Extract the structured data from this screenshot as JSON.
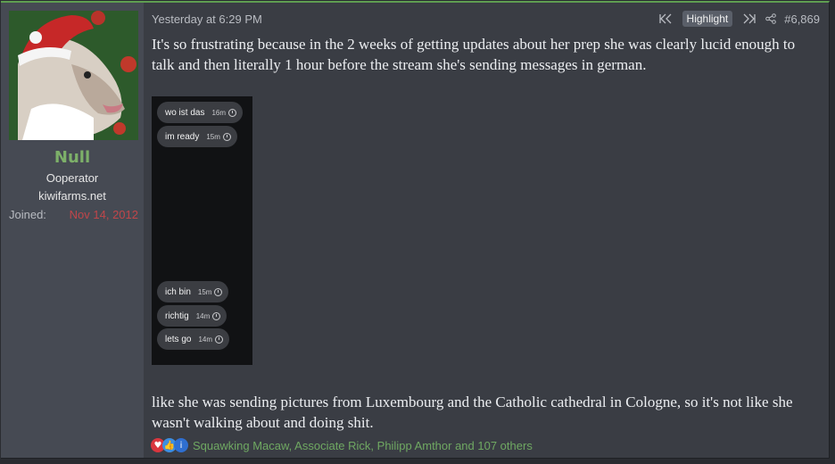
{
  "user": {
    "name": "Null",
    "title": "Ooperator",
    "banner": "kiwifarms.net",
    "joined_label": "Joined:",
    "joined_date": "Nov 14, 2012"
  },
  "post": {
    "date": "Yesterday at 6:29 PM",
    "highlight_label": "Highlight",
    "number": "#6,869",
    "paragraph1": "It's so frustrating because in the 2 weeks of getting updates about her prep she was clearly lucid enough to talk and then literally 1 hour before the stream she's sending messages in german.",
    "paragraph2": "like she was sending pictures from Luxembourg and the Catholic cathedral in Cologne, so it's not like she wasn't walking about and doing shit."
  },
  "attachment": {
    "messages": [
      {
        "text": "wo ist das",
        "time": "16m"
      },
      {
        "text": "im ready",
        "time": "15m"
      },
      {
        "text": "ich bin",
        "time": "15m"
      },
      {
        "text": "richtig",
        "time": "14m"
      },
      {
        "text": "lets go",
        "time": "14m"
      }
    ]
  },
  "reactions": {
    "icons": [
      "heart-icon",
      "thumbs-up-icon",
      "info-icon"
    ],
    "colors": {
      "heart": "#d9363e",
      "like": "#3d8ee0",
      "info": "#2f6fd1"
    },
    "users_text": "Squawking Macaw, Associate Rick, Philipp Amthor and 107 others"
  },
  "colors": {
    "accent_green": "#5f9e51",
    "username": "#7db069",
    "joined_date": "#c0464a",
    "post_bg": "#3a3d44",
    "sidebar_bg": "#464a53"
  }
}
